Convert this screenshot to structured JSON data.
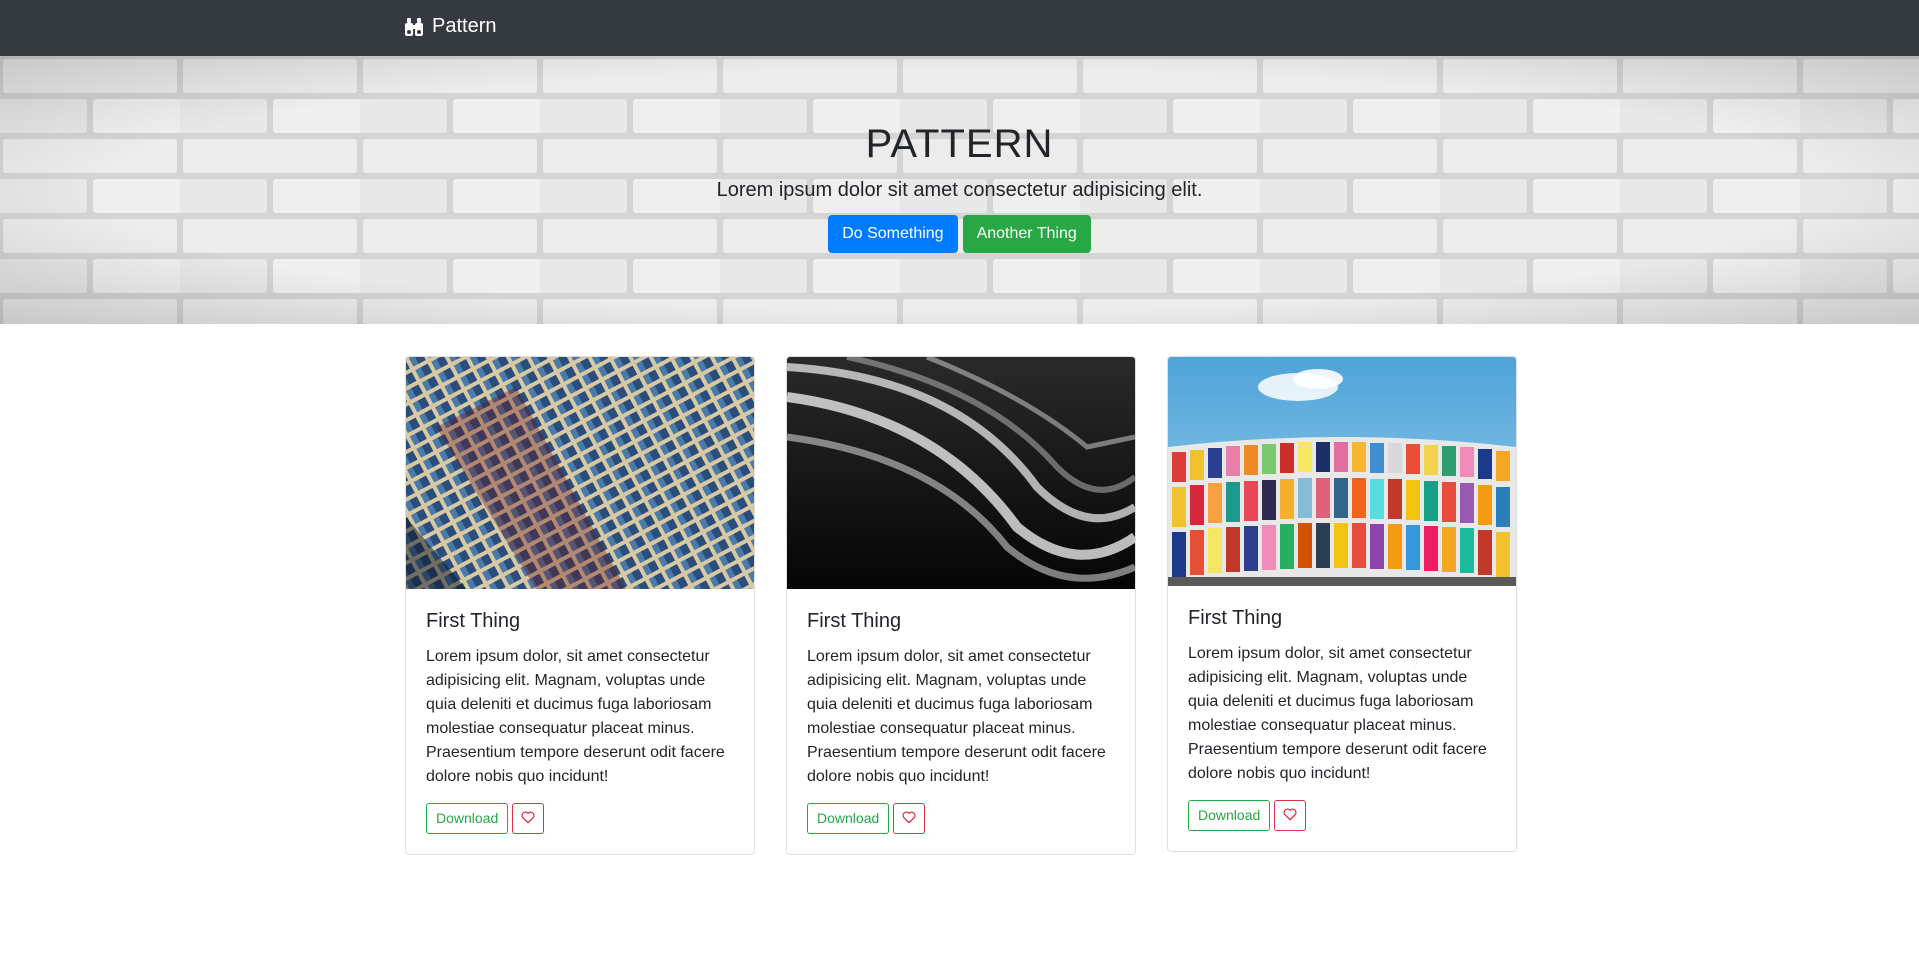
{
  "navbar": {
    "brand_icon": "binoculars-icon",
    "brand_label": "Pattern"
  },
  "hero": {
    "title": "PATTERN",
    "subtitle": "Lorem ipsum dolor sit amet consectetur adipisicing elit.",
    "primary_button": "Do Something",
    "secondary_button": "Another Thing"
  },
  "cards": [
    {
      "title": "First Thing",
      "text": "Lorem ipsum dolor, sit amet consectetur adipisicing elit. Magnam, voluptas unde quia deleniti et ducimus fuga laboriosam molestiae consequatur placeat minus. Praesentium tempore deserunt odit facere dolore nobis quo incidunt!",
      "download_label": "Download",
      "like_icon": "heart-icon"
    },
    {
      "title": "First Thing",
      "text": "Lorem ipsum dolor, sit amet consectetur adipisicing elit. Magnam, voluptas unde quia deleniti et ducimus fuga laboriosam molestiae consequatur placeat minus. Praesentium tempore deserunt odit facere dolore nobis quo incidunt!",
      "download_label": "Download",
      "like_icon": "heart-icon"
    },
    {
      "title": "First Thing",
      "text": "Lorem ipsum dolor, sit amet consectetur adipisicing elit. Magnam, voluptas unde quia deleniti et ducimus fuga laboriosam molestiae consequatur placeat minus. Praesentium tempore deserunt odit facere dolore nobis quo incidunt!",
      "download_label": "Download",
      "like_icon": "heart-icon"
    }
  ],
  "colors": {
    "navbar_bg": "#343a40",
    "primary": "#007bff",
    "success": "#28a745",
    "danger": "#dc3545"
  }
}
